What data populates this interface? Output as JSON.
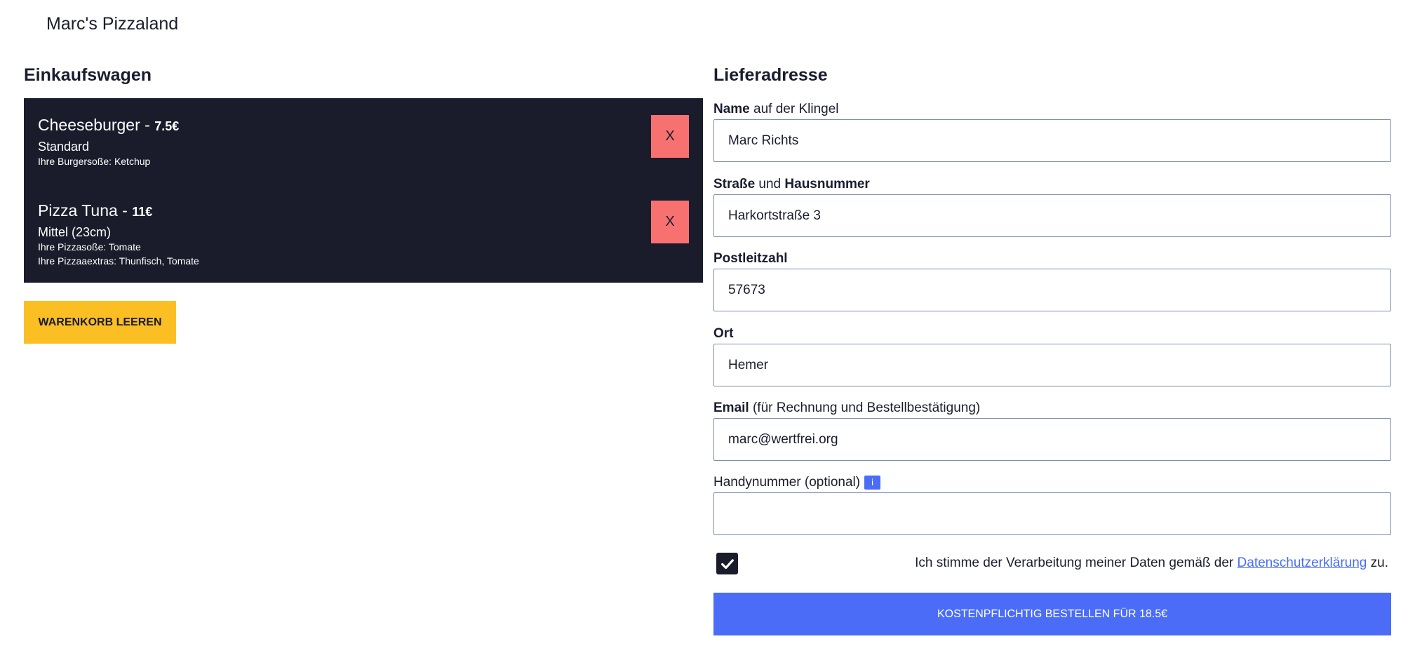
{
  "header": {
    "brand": "Marc's Pizzaland"
  },
  "cart": {
    "title": "Einkaufswagen",
    "items": [
      {
        "name": "Cheeseburger",
        "sep": " - ",
        "price": "7.5€",
        "size": "Standard",
        "details": [
          "Ihre Burgersoße: Ketchup"
        ],
        "remove_label": "X"
      },
      {
        "name": "Pizza Tuna",
        "sep": " - ",
        "price": "11€",
        "size": "Mittel (23cm)",
        "details": [
          "Ihre Pizzasoße: Tomate",
          "Ihre Pizzaaextras: Thunfisch, Tomate"
        ],
        "remove_label": "X"
      }
    ],
    "clear_label": "Warenkorb leeren"
  },
  "address": {
    "title": "Lieferadresse",
    "name": {
      "label_bold": "Name",
      "label_rest": " auf der Klingel",
      "value": "Marc Richts"
    },
    "street": {
      "label_bold1": "Straße",
      "label_mid": " und ",
      "label_bold2": "Hausnummer",
      "value": "Harkortstraße 3"
    },
    "zip": {
      "label_bold": "Postleitzahl",
      "value": "57673"
    },
    "city": {
      "label_bold": "Ort",
      "value": "Hemer"
    },
    "email": {
      "label_bold": "Email",
      "label_rest": " (für Rechnung und Bestellbestätigung)",
      "value": "marc@wertfrei.org"
    },
    "phone": {
      "label": "Handynummer (optional)",
      "info": "i",
      "value": ""
    },
    "consent": {
      "checked": true,
      "text_before": "Ich stimme der Verarbeitung meiner Daten gemäß der ",
      "link": "Datenschutzerklärung",
      "text_after": " zu."
    },
    "order_label": "Kostenpflichtig bestellen für 18.5€"
  },
  "colors": {
    "dark": "#1b1c2b",
    "danger": "#f87171",
    "warning": "#fbbf24",
    "primary": "#4a6cf7"
  }
}
